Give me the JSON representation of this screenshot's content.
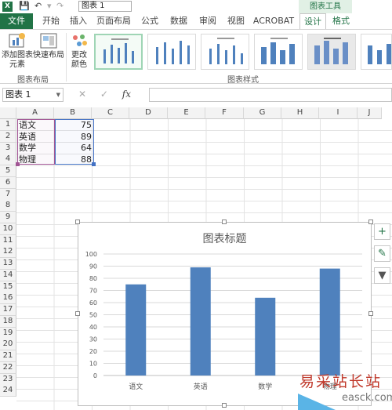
{
  "titlebar": {
    "logo": "X",
    "name_box_top": "图表 1",
    "chart_tools_label": "图表工具"
  },
  "tabs": [
    "文件",
    "开始",
    "插入",
    "页面布局",
    "公式",
    "数据",
    "审阅",
    "视图",
    "ACROBAT",
    "设计",
    "格式"
  ],
  "ribbon": {
    "add_element_label": "添加图表\n元素",
    "quick_layout_label": "快速布局",
    "change_color_label": "更改\n颜色",
    "group_layout_label": "图表布局",
    "group_styles_label": "图表样式"
  },
  "formula_bar": {
    "name_box": "图表 1",
    "fx_label": "fx",
    "cancel_symbol": "✕",
    "enter_symbol": "✓"
  },
  "columns": [
    "A",
    "B",
    "C",
    "D",
    "E",
    "F",
    "G",
    "H",
    "I",
    "J"
  ],
  "rows": [
    "1",
    "2",
    "3",
    "4",
    "5",
    "6",
    "7",
    "8",
    "9",
    "10",
    "11",
    "12",
    "13",
    "14",
    "15",
    "16",
    "17",
    "18",
    "19",
    "20",
    "21",
    "22",
    "23",
    "24"
  ],
  "cells": [
    {
      "subject": "语文",
      "score": "75"
    },
    {
      "subject": "英语",
      "score": "89"
    },
    {
      "subject": "数学",
      "score": "64"
    },
    {
      "subject": "物理",
      "score": "88"
    }
  ],
  "chart_data": {
    "type": "bar",
    "title": "图表标题",
    "categories": [
      "语文",
      "英语",
      "数学",
      "物理"
    ],
    "values": [
      75,
      89,
      64,
      88
    ],
    "ylim": [
      0,
      100
    ],
    "yticks": [
      "0",
      "10",
      "20",
      "30",
      "40",
      "50",
      "60",
      "70",
      "80",
      "90",
      "100"
    ],
    "grid": true,
    "bar_color": "#4f81bd"
  },
  "side_buttons": [
    "+",
    "✎",
    "▼"
  ],
  "watermark": {
    "text": "易采站长站",
    "url": "easck.com"
  },
  "colors": {
    "accent": "#217346",
    "bar": "#4f81bd"
  }
}
